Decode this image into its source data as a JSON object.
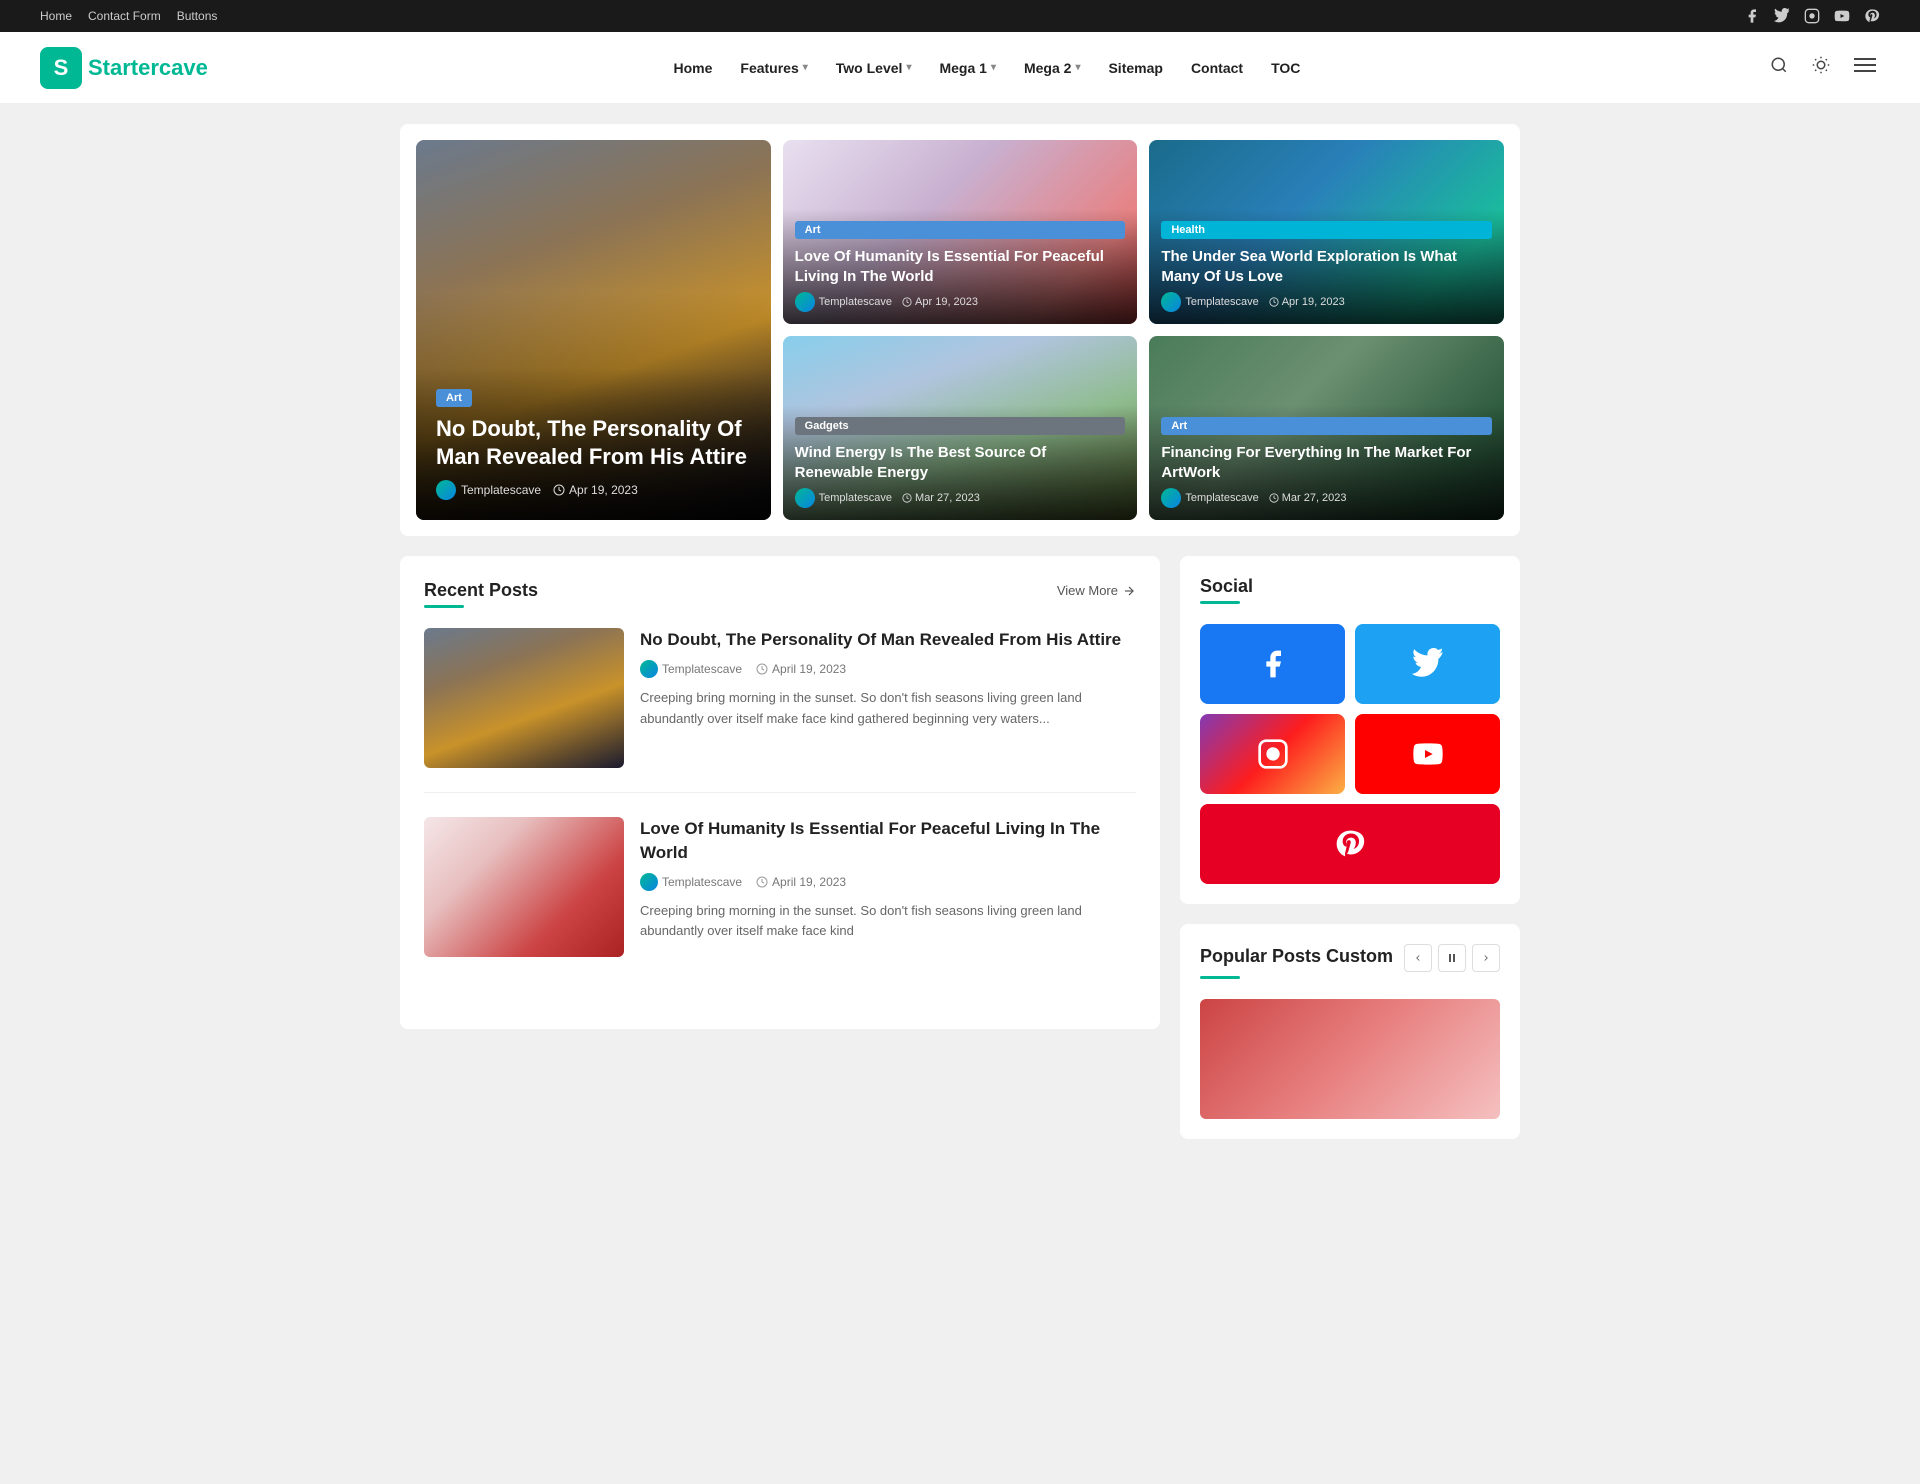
{
  "topbar": {
    "links": [
      "Home",
      "Contact Form",
      "Buttons"
    ],
    "socials": [
      "facebook",
      "twitter",
      "instagram",
      "youtube",
      "pinterest"
    ]
  },
  "header": {
    "logo_letter": "S",
    "logo_brand": "Starter",
    "logo_brand2": "cave",
    "nav": [
      {
        "label": "Home",
        "has_dropdown": false
      },
      {
        "label": "Features",
        "has_dropdown": true
      },
      {
        "label": "Two Level",
        "has_dropdown": true
      },
      {
        "label": "Mega 1",
        "has_dropdown": true
      },
      {
        "label": "Mega 2",
        "has_dropdown": true
      },
      {
        "label": "Sitemap",
        "has_dropdown": false
      },
      {
        "label": "Contact",
        "has_dropdown": false
      },
      {
        "label": "TOC",
        "has_dropdown": false
      }
    ]
  },
  "hero": {
    "main": {
      "tag": "Art",
      "title": "No Doubt, The Personality Of Man Revealed From His Attire",
      "author": "Templatescave",
      "date": "Apr 19, 2023"
    },
    "card1": {
      "tag": "Art",
      "title": "Love Of Humanity Is Essential For Peaceful Living In The World",
      "author": "Templatescave",
      "date": "Apr 19, 2023"
    },
    "card2": {
      "tag": "Health",
      "title": "The Under Sea World Exploration Is What Many Of Us Love",
      "author": "Templatescave",
      "date": "Apr 19, 2023"
    },
    "card3": {
      "tag": "Gadgets",
      "title": "Wind Energy Is The Best Source Of Renewable Energy",
      "author": "Templatescave",
      "date": "Mar 27, 2023"
    },
    "card4": {
      "tag": "Art",
      "title": "Financing For Everything In The Market For ArtWork",
      "author": "Templatescave",
      "date": "Mar 27, 2023"
    }
  },
  "recent_posts": {
    "title": "Recent Posts",
    "view_more": "View More",
    "posts": [
      {
        "title": "No Doubt, The Personality Of Man Revealed From His Attire",
        "author": "Templatescave",
        "date": "April 19, 2023",
        "excerpt": "Creeping bring morning in the sunset. So don't fish seasons living green land abundantly over itself make face kind gathered beginning very waters...",
        "img_class": "man"
      },
      {
        "title": "Love Of Humanity Is Essential For Peaceful Living In The World",
        "author": "Templatescave",
        "date": "April 19, 2023",
        "excerpt": "Creeping bring morning in the sunset. So don't fish seasons living green land abundantly over itself make face kind",
        "img_class": "red-heart"
      }
    ]
  },
  "sidebar": {
    "social_title": "Social",
    "social_buttons": [
      {
        "label": "facebook",
        "class": "facebook",
        "icon": "f"
      },
      {
        "label": "twitter",
        "class": "twitter",
        "icon": "t"
      },
      {
        "label": "instagram",
        "class": "instagram",
        "icon": "i"
      },
      {
        "label": "youtube",
        "class": "youtube",
        "icon": "y"
      },
      {
        "label": "pinterest",
        "class": "pinterest",
        "icon": "p"
      }
    ],
    "popular_title": "Popular Posts Custom"
  },
  "icons": {
    "clock": "🕐",
    "chevron_right": "→",
    "chevron_left": "‹",
    "chevron_right_sm": "›",
    "pause": "⏸",
    "search": "🔍",
    "sun": "☀",
    "menu": "☰"
  }
}
